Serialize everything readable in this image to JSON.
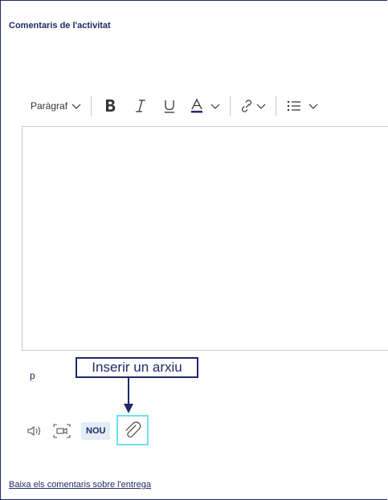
{
  "panel": {
    "title": "Comentaris de l'activitat"
  },
  "toolbar": {
    "paragraph_label": "Paràgraf",
    "icons": [
      "bold-icon",
      "italic-icon",
      "underline-icon",
      "text-color-icon",
      "link-icon",
      "list-icon"
    ]
  },
  "editor": {
    "path_label": "p"
  },
  "callout": {
    "text": "Inserir un arxiu"
  },
  "bottom_tools": {
    "badge_label": "NOU",
    "icons": [
      "audio-icon",
      "video-icon",
      "attach-icon"
    ]
  },
  "footer": {
    "link_text": "Baixa els comentaris sobre l'entrega"
  },
  "colors": {
    "accent": "#1f2a68",
    "highlight": "#6ee0f0",
    "badge_bg": "#e3ecf7"
  }
}
